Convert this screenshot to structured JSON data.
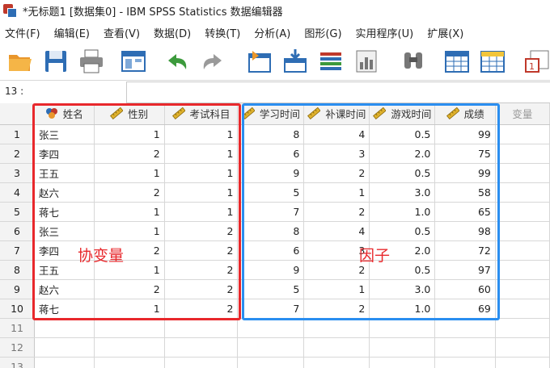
{
  "window": {
    "title": "*无标题1 [数据集0] - IBM SPSS Statistics 数据编辑器"
  },
  "menu": [
    "文件(F)",
    "编辑(E)",
    "查看(V)",
    "数据(D)",
    "转换(T)",
    "分析(A)",
    "图形(G)",
    "实用程序(U)",
    "扩展(X)"
  ],
  "toolbar": {
    "icons": [
      "open-folder",
      "save-disk",
      "print",
      "recall-dialog",
      "undo",
      "redo",
      "goto-case",
      "goto-variable",
      "variables",
      "chart-builder",
      "find",
      "insert-cases",
      "insert-variable",
      "split-file"
    ],
    "colors": {
      "orange": "#f2a33a",
      "blue": "#2e6db4",
      "green": "#3c9a3c",
      "red": "#c0392b"
    }
  },
  "cellbar": {
    "ref": "13 :",
    "value": ""
  },
  "columns": [
    {
      "label": "姓名",
      "icon": "nominal-icon"
    },
    {
      "label": "性别",
      "icon": "scale-ruler-icon"
    },
    {
      "label": "考试科目",
      "icon": "scale-ruler-icon"
    },
    {
      "label": "学习时间",
      "icon": "scale-ruler-icon"
    },
    {
      "label": "补课时间",
      "icon": "scale-ruler-icon"
    },
    {
      "label": "游戏时间",
      "icon": "scale-ruler-icon"
    },
    {
      "label": "成绩",
      "icon": "scale-ruler-icon"
    },
    {
      "label": "变量",
      "icon": ""
    }
  ],
  "rows": [
    {
      "n": "1",
      "cells": [
        "张三",
        "1",
        "1",
        "8",
        "4",
        "0.5",
        "99",
        ""
      ]
    },
    {
      "n": "2",
      "cells": [
        "李四",
        "2",
        "1",
        "6",
        "3",
        "2.0",
        "75",
        ""
      ]
    },
    {
      "n": "3",
      "cells": [
        "王五",
        "1",
        "1",
        "9",
        "2",
        "0.5",
        "99",
        ""
      ]
    },
    {
      "n": "4",
      "cells": [
        "赵六",
        "2",
        "1",
        "5",
        "1",
        "3.0",
        "58",
        ""
      ]
    },
    {
      "n": "5",
      "cells": [
        "蒋七",
        "1",
        "1",
        "7",
        "2",
        "1.0",
        "65",
        ""
      ]
    },
    {
      "n": "6",
      "cells": [
        "张三",
        "1",
        "2",
        "8",
        "4",
        "0.5",
        "98",
        ""
      ]
    },
    {
      "n": "7",
      "cells": [
        "李四",
        "2",
        "2",
        "6",
        "3",
        "2.0",
        "72",
        ""
      ]
    },
    {
      "n": "8",
      "cells": [
        "王五",
        "1",
        "2",
        "9",
        "2",
        "0.5",
        "97",
        ""
      ]
    },
    {
      "n": "9",
      "cells": [
        "赵六",
        "2",
        "2",
        "5",
        "1",
        "3.0",
        "60",
        ""
      ]
    },
    {
      "n": "10",
      "cells": [
        "蒋七",
        "1",
        "2",
        "7",
        "2",
        "1.0",
        "69",
        ""
      ]
    },
    {
      "n": "11",
      "cells": [
        "",
        "",
        "",
        "",
        "",
        "",
        "",
        ""
      ]
    },
    {
      "n": "12",
      "cells": [
        "",
        "",
        "",
        "",
        "",
        "",
        "",
        ""
      ]
    },
    {
      "n": "13",
      "cells": [
        "",
        "",
        "",
        "",
        "",
        "",
        "",
        ""
      ]
    }
  ],
  "annotations": {
    "covariate_label": "协变量",
    "factor_label": "因子",
    "covariate_color": "#e8282c",
    "factor_color": "#2a8ef0"
  }
}
